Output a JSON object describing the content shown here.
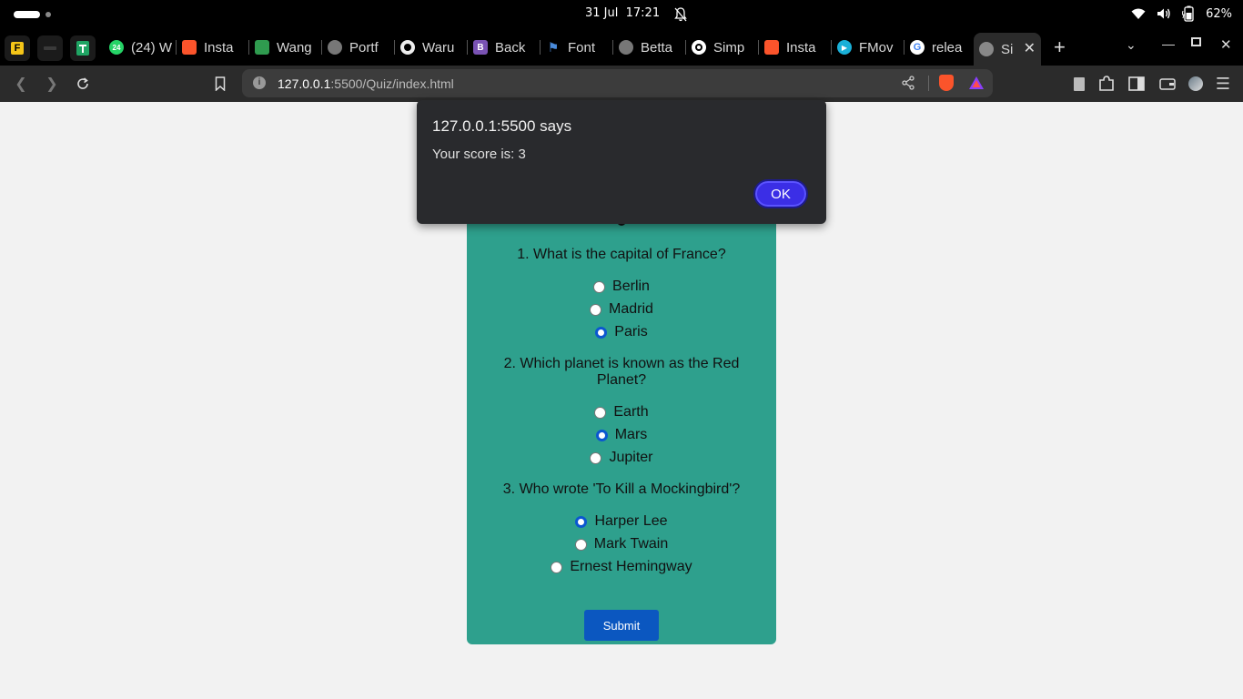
{
  "os": {
    "clock": "31 Jul  17:21",
    "battery": "62%"
  },
  "tabs": [
    {
      "label": "(24) W",
      "icon": "whatsapp-icon"
    },
    {
      "label": "Insta",
      "icon": "brave-icon"
    },
    {
      "label": "Wang",
      "icon": "app-icon"
    },
    {
      "label": "Portf",
      "icon": "globe-icon"
    },
    {
      "label": "Waru",
      "icon": "github-icon"
    },
    {
      "label": "Back",
      "icon": "bootstrap-icon"
    },
    {
      "label": "Font",
      "icon": "flag-icon"
    },
    {
      "label": "Betta",
      "icon": "globe-icon"
    },
    {
      "label": "Simp",
      "icon": "openai-icon"
    },
    {
      "label": "Insta",
      "icon": "brave-icon"
    },
    {
      "label": "FMov",
      "icon": "play-icon"
    },
    {
      "label": "relea",
      "icon": "google-icon"
    },
    {
      "label": "Si",
      "icon": "globe-icon"
    }
  ],
  "address": {
    "host": "127.0.0.1",
    "rest": ":5500/Quiz/index.html"
  },
  "quiz": {
    "questions": [
      {
        "text": "1. What is the capital of France?",
        "options": [
          "Berlin",
          "Madrid",
          "Paris"
        ],
        "selected": "Paris"
      },
      {
        "text": "2. Which planet is known as the Red Planet?",
        "options": [
          "Earth",
          "Mars",
          "Jupiter"
        ],
        "selected": "Mars"
      },
      {
        "text": "3. Who wrote 'To Kill a Mockingbird'?",
        "options": [
          "Harper Lee",
          "Mark Twain",
          "Ernest Hemingway"
        ],
        "selected": "Harper Lee"
      }
    ],
    "submit_label": "Submit"
  },
  "dialog": {
    "origin": "127.0.0.1:5500 says",
    "message": "Your score is: 3",
    "ok_label": "OK"
  },
  "colors": {
    "quiz_bg": "#2ea08d",
    "submit_bg": "#0b57c0",
    "dialog_bg": "#292a2d",
    "ok_bg": "#3b2ee6"
  }
}
